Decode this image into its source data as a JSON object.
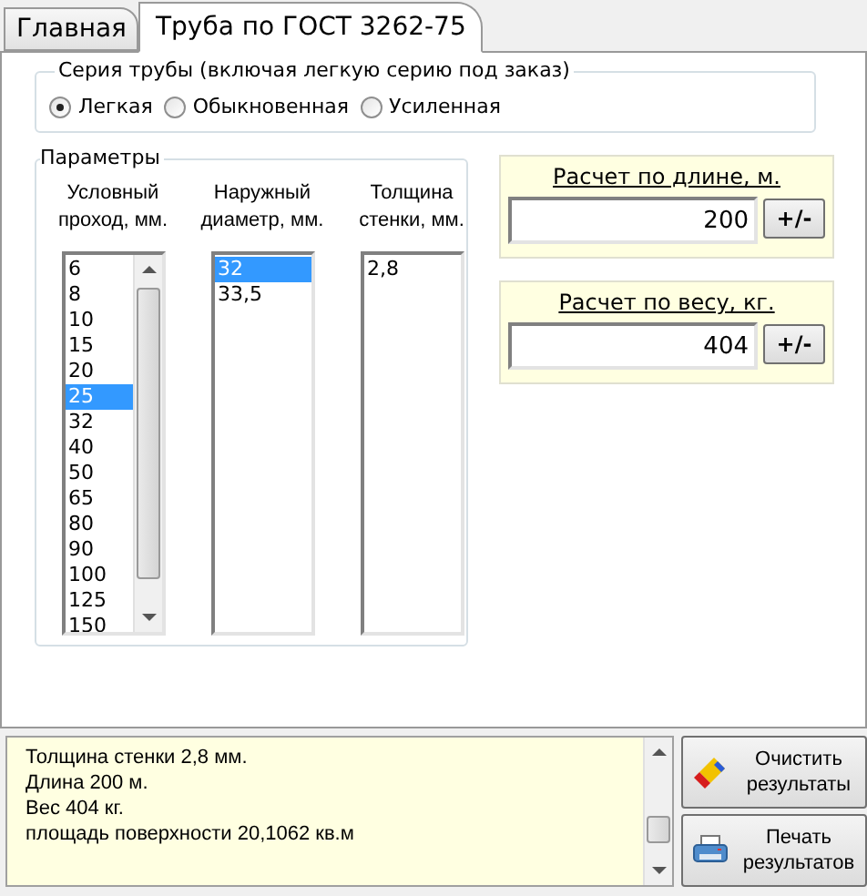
{
  "tabs": [
    {
      "label": "Главная",
      "selected": false
    },
    {
      "label": "Труба по ГОСТ 3262-75",
      "selected": true
    }
  ],
  "series": {
    "title": "Серия трубы (включая легкую серию под заказ)",
    "options": [
      {
        "label": "Легкая",
        "selected": true
      },
      {
        "label": "Обыкновенная",
        "selected": false
      },
      {
        "label": "Усиленная",
        "selected": false
      }
    ]
  },
  "parameters": {
    "title": "Параметры",
    "lists": [
      {
        "heading": "Условный проход, мм.",
        "scrollbar": true,
        "items": [
          {
            "label": "6",
            "selected": false
          },
          {
            "label": "8",
            "selected": false
          },
          {
            "label": "10",
            "selected": false
          },
          {
            "label": "15",
            "selected": false
          },
          {
            "label": "20",
            "selected": false
          },
          {
            "label": "25",
            "selected": true
          },
          {
            "label": "32",
            "selected": false
          },
          {
            "label": "40",
            "selected": false
          },
          {
            "label": "50",
            "selected": false
          },
          {
            "label": "65",
            "selected": false
          },
          {
            "label": "80",
            "selected": false
          },
          {
            "label": "90",
            "selected": false
          },
          {
            "label": "100",
            "selected": false
          },
          {
            "label": "125",
            "selected": false
          },
          {
            "label": "150",
            "selected": false
          }
        ]
      },
      {
        "heading": "Наружный диаметр, мм.",
        "scrollbar": false,
        "items": [
          {
            "label": "32",
            "selected": true
          },
          {
            "label": "33,5",
            "selected": false
          }
        ]
      },
      {
        "heading": "Толщина стенки, мм.",
        "scrollbar": false,
        "items": [
          {
            "label": "2,8",
            "selected": false
          }
        ]
      }
    ]
  },
  "calculators": [
    {
      "title": "Расчет по длине, м.",
      "value": "200",
      "button": "+/-"
    },
    {
      "title": "Расчет по весу, кг.",
      "value": "404",
      "button": "+/-"
    }
  ],
  "results": {
    "lines": [
      "Толщина стенки 2,8 мм.",
      "Длина 200 м.",
      "Вес 404 кг.",
      "площадь поверхности 20,1062 кв.м"
    ],
    "buttons": [
      {
        "label": "Очистить результаты",
        "kind": "clear"
      },
      {
        "label": "Печать результатов",
        "kind": "print"
      }
    ]
  }
}
